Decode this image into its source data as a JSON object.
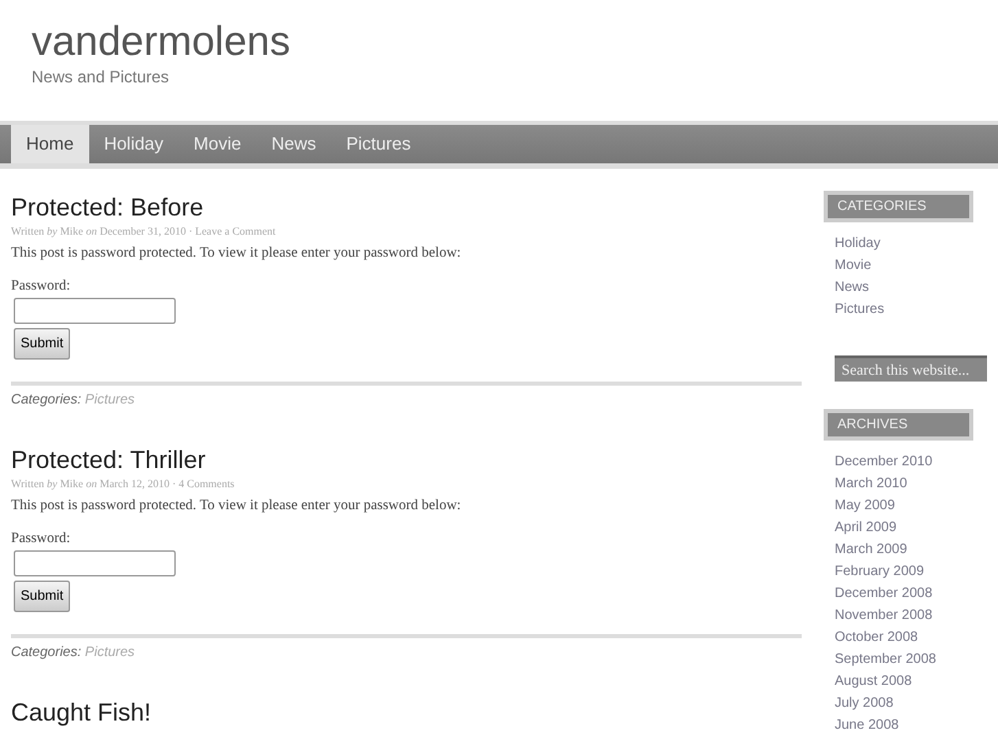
{
  "site": {
    "title": "vandermolens",
    "tagline": "News and Pictures"
  },
  "nav": [
    {
      "label": "Home",
      "selected": true
    },
    {
      "label": "Holiday",
      "selected": false
    },
    {
      "label": "Movie",
      "selected": false
    },
    {
      "label": "News",
      "selected": false
    },
    {
      "label": "Pictures",
      "selected": false
    }
  ],
  "posts": [
    {
      "title": "Protected: Before",
      "meta": "Written *by* Mike *on* December 31, 2010 · Leave a Comment",
      "message": "This post is password protected. To view it please enter your password below:",
      "password_label": "Password:",
      "button": "Submit",
      "categories_label": "Categories:",
      "category": "Pictures"
    },
    {
      "title": "Protected: Thriller",
      "meta": "Written *by* Mike *on* March 12, 2010 · 4 Comments",
      "message": "This post is password protected. To view it please enter your password below:",
      "password_label": "Password:",
      "button": "Submit",
      "categories_label": "Categories:",
      "category": "Pictures"
    },
    {
      "title": "Caught Fish!"
    }
  ],
  "sidebar": {
    "categories": {
      "heading": "CATEGORIES",
      "items": [
        "Holiday",
        "Movie",
        "News",
        "Pictures"
      ]
    },
    "search": {
      "placeholder": "Search this website..."
    },
    "archives": {
      "heading": "ARCHIVES",
      "items": [
        "December 2010",
        "March 2010",
        "May 2009",
        "April 2009",
        "March 2009",
        "February 2009",
        "December 2008",
        "November 2008",
        "October 2008",
        "September 2008",
        "August 2008",
        "July 2008",
        "June 2008"
      ]
    }
  }
}
